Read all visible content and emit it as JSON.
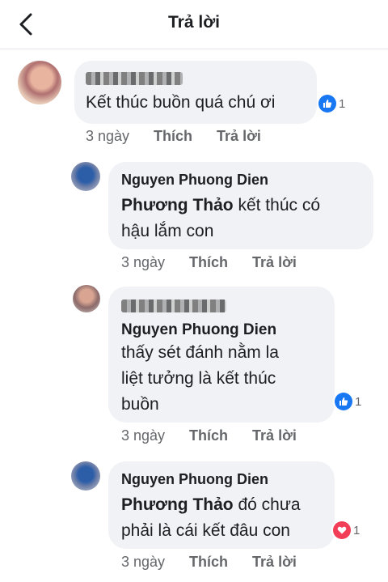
{
  "header": {
    "title": "Trả lời"
  },
  "actions": {
    "time": "3 ngày",
    "like": "Thích",
    "reply": "Trả lời"
  },
  "comments": [
    {
      "name": "",
      "text": "Kết thúc buồn quá chú ơi",
      "reactions": "1",
      "reaction_type": "like"
    },
    {
      "name": "Nguyen Phuong Dien",
      "tag": "Phương Thảo",
      "text_line1": " kết thúc có",
      "text_line2": "hậu lắm con"
    },
    {
      "name": "",
      "mention": "Nguyen Phuong Dien",
      "text_line1": "thấy sét đánh nằm la",
      "text_line2": "liệt tưởng là kết thúc",
      "text_line3": "buồn",
      "reactions": "1",
      "reaction_type": "like"
    },
    {
      "name": "Nguyen Phuong Dien",
      "tag": "Phương Thảo",
      "text_line1": " đó chưa",
      "text_line2": "phải là cái kết đâu con",
      "reactions": "1",
      "reaction_type": "love"
    }
  ],
  "colors": {
    "like": "#1877f2",
    "love": "#f33e58",
    "bubble": "#f0f2f5",
    "meta": "#65676b"
  }
}
